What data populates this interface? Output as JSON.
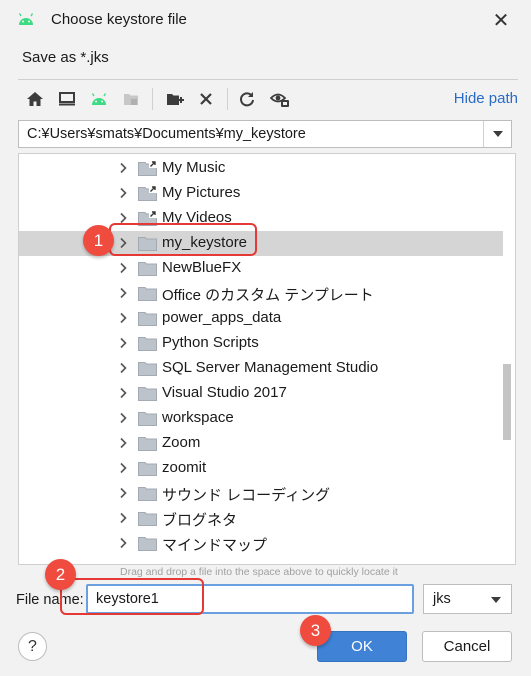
{
  "window": {
    "title": "Choose keystore file",
    "subtitle": "Save as *.jks",
    "close_glyph": "✕"
  },
  "toolbar": {
    "icons": [
      "home-icon",
      "desktop-icon",
      "android-project-icon",
      "module-icon",
      "new-folder-icon",
      "delete-icon",
      "refresh-icon",
      "show-hidden-icon"
    ],
    "hide_path_label": "Hide path"
  },
  "path": {
    "value": "C:¥Users¥smats¥Documents¥my_keystore"
  },
  "tree": {
    "items": [
      {
        "label": "My Music",
        "shortcut": true,
        "selected": false
      },
      {
        "label": "My Pictures",
        "shortcut": true,
        "selected": false
      },
      {
        "label": "My Videos",
        "shortcut": true,
        "selected": false
      },
      {
        "label": "my_keystore",
        "shortcut": false,
        "selected": true
      },
      {
        "label": "NewBlueFX",
        "shortcut": false,
        "selected": false
      },
      {
        "label": "Office のカスタム テンプレート",
        "shortcut": false,
        "selected": false
      },
      {
        "label": "power_apps_data",
        "shortcut": false,
        "selected": false
      },
      {
        "label": "Python Scripts",
        "shortcut": false,
        "selected": false
      },
      {
        "label": "SQL Server Management Studio",
        "shortcut": false,
        "selected": false
      },
      {
        "label": "Visual Studio 2017",
        "shortcut": false,
        "selected": false
      },
      {
        "label": "workspace",
        "shortcut": false,
        "selected": false
      },
      {
        "label": "Zoom",
        "shortcut": false,
        "selected": false
      },
      {
        "label": "zoomit",
        "shortcut": false,
        "selected": false
      },
      {
        "label": "サウンド レコーディング",
        "shortcut": false,
        "selected": false
      },
      {
        "label": "ブログネタ",
        "shortcut": false,
        "selected": false
      },
      {
        "label": "マインドマップ",
        "shortcut": false,
        "selected": false
      }
    ]
  },
  "hint": "Drag and drop a file into the space above to quickly locate it",
  "file_name": {
    "label": "File name:",
    "value": "keystore1",
    "extension": "jks"
  },
  "buttons": {
    "help": "?",
    "ok": "OK",
    "cancel": "Cancel"
  },
  "annotations": [
    {
      "number": "1"
    },
    {
      "number": "2"
    },
    {
      "number": "3"
    }
  ],
  "colors": {
    "accent": "#3f82d6",
    "link": "#2a6bc6",
    "annotation": "#e53935",
    "android_green": "#3ddc84"
  }
}
